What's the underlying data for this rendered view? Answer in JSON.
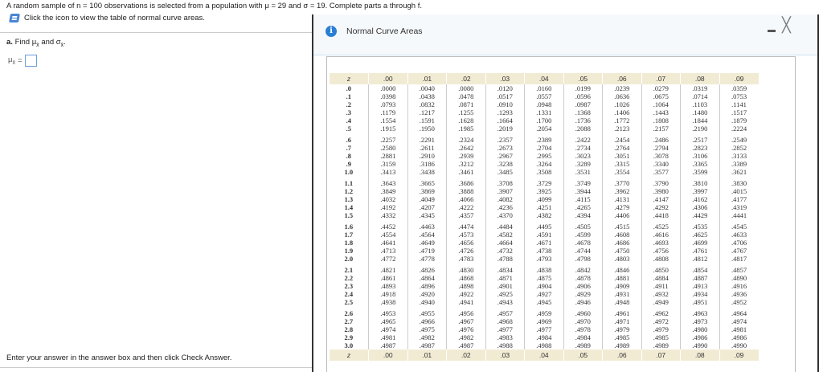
{
  "question": "A random sample of n = 100 observations is selected from a population with μ = 29 and σ = 19. Complete parts a through f.",
  "hint": "Click the icon to view the table of normal curve areas.",
  "part_a": {
    "label": "a.",
    "text": "Find μ",
    "and": "and σ",
    "sub": "x̄",
    "end": "."
  },
  "answer": {
    "label": "μ",
    "sub": "x̄",
    "eq": "=",
    "value": ""
  },
  "footer": "Enter your answer in the answer box and then click Check Answer.",
  "popup": {
    "title": "Normal Curve Areas",
    "info_icon": "i",
    "minimize": "minimize-icon",
    "close": "╳",
    "headers": [
      "z",
      ".00",
      ".01",
      ".02",
      ".03",
      ".04",
      ".05",
      ".06",
      ".07",
      ".08",
      ".09"
    ],
    "groups": [
      [
        [
          ".0",
          ".0000",
          ".0040",
          ".0080",
          ".0120",
          ".0160",
          ".0199",
          ".0239",
          ".0279",
          ".0319",
          ".0359"
        ],
        [
          ".1",
          ".0398",
          ".0438",
          ".0478",
          ".0517",
          ".0557",
          ".0596",
          ".0636",
          ".0675",
          ".0714",
          ".0753"
        ],
        [
          ".2",
          ".0793",
          ".0832",
          ".0871",
          ".0910",
          ".0948",
          ".0987",
          ".1026",
          ".1064",
          ".1103",
          ".1141"
        ],
        [
          ".3",
          ".1179",
          ".1217",
          ".1255",
          ".1293",
          ".1331",
          ".1368",
          ".1406",
          ".1443",
          ".1480",
          ".1517"
        ],
        [
          ".4",
          ".1554",
          ".1591",
          ".1628",
          ".1664",
          ".1700",
          ".1736",
          ".1772",
          ".1808",
          ".1844",
          ".1879"
        ],
        [
          ".5",
          ".1915",
          ".1950",
          ".1985",
          ".2019",
          ".2054",
          ".2088",
          ".2123",
          ".2157",
          ".2190",
          ".2224"
        ]
      ],
      [
        [
          ".6",
          ".2257",
          ".2291",
          ".2324",
          ".2357",
          ".2389",
          ".2422",
          ".2454",
          ".2486",
          ".2517",
          ".2549"
        ],
        [
          ".7",
          ".2580",
          ".2611",
          ".2642",
          ".2673",
          ".2704",
          ".2734",
          ".2764",
          ".2794",
          ".2823",
          ".2852"
        ],
        [
          ".8",
          ".2881",
          ".2910",
          ".2939",
          ".2967",
          ".2995",
          ".3023",
          ".3051",
          ".3078",
          ".3106",
          ".3133"
        ],
        [
          ".9",
          ".3159",
          ".3186",
          ".3212",
          ".3238",
          ".3264",
          ".3289",
          ".3315",
          ".3340",
          ".3365",
          ".3389"
        ],
        [
          "1.0",
          ".3413",
          ".3438",
          ".3461",
          ".3485",
          ".3508",
          ".3531",
          ".3554",
          ".3577",
          ".3599",
          ".3621"
        ]
      ],
      [
        [
          "1.1",
          ".3643",
          ".3665",
          ".3686",
          ".3708",
          ".3729",
          ".3749",
          ".3770",
          ".3790",
          ".3810",
          ".3830"
        ],
        [
          "1.2",
          ".3849",
          ".3869",
          ".3888",
          ".3907",
          ".3925",
          ".3944",
          ".3962",
          ".3980",
          ".3997",
          ".4015"
        ],
        [
          "1.3",
          ".4032",
          ".4049",
          ".4066",
          ".4082",
          ".4099",
          ".4115",
          ".4131",
          ".4147",
          ".4162",
          ".4177"
        ],
        [
          "1.4",
          ".4192",
          ".4207",
          ".4222",
          ".4236",
          ".4251",
          ".4265",
          ".4279",
          ".4292",
          ".4306",
          ".4319"
        ],
        [
          "1.5",
          ".4332",
          ".4345",
          ".4357",
          ".4370",
          ".4382",
          ".4394",
          ".4406",
          ".4418",
          ".4429",
          ".4441"
        ]
      ],
      [
        [
          "1.6",
          ".4452",
          ".4463",
          ".4474",
          ".4484",
          ".4495",
          ".4505",
          ".4515",
          ".4525",
          ".4535",
          ".4545"
        ],
        [
          "1.7",
          ".4554",
          ".4564",
          ".4573",
          ".4582",
          ".4591",
          ".4599",
          ".4608",
          ".4616",
          ".4625",
          ".4633"
        ],
        [
          "1.8",
          ".4641",
          ".4649",
          ".4656",
          ".4664",
          ".4671",
          ".4678",
          ".4686",
          ".4693",
          ".4699",
          ".4706"
        ],
        [
          "1.9",
          ".4713",
          ".4719",
          ".4726",
          ".4732",
          ".4738",
          ".4744",
          ".4750",
          ".4756",
          ".4761",
          ".4767"
        ],
        [
          "2.0",
          ".4772",
          ".4778",
          ".4783",
          ".4788",
          ".4793",
          ".4798",
          ".4803",
          ".4808",
          ".4812",
          ".4817"
        ]
      ],
      [
        [
          "2.1",
          ".4821",
          ".4826",
          ".4830",
          ".4834",
          ".4838",
          ".4842",
          ".4846",
          ".4850",
          ".4854",
          ".4857"
        ],
        [
          "2.2",
          ".4861",
          ".4864",
          ".4868",
          ".4871",
          ".4875",
          ".4878",
          ".4881",
          ".4884",
          ".4887",
          ".4890"
        ],
        [
          "2.3",
          ".4893",
          ".4896",
          ".4898",
          ".4901",
          ".4904",
          ".4906",
          ".4909",
          ".4911",
          ".4913",
          ".4916"
        ],
        [
          "2.4",
          ".4918",
          ".4920",
          ".4922",
          ".4925",
          ".4927",
          ".4929",
          ".4931",
          ".4932",
          ".4934",
          ".4936"
        ],
        [
          "2.5",
          ".4938",
          ".4940",
          ".4941",
          ".4943",
          ".4945",
          ".4946",
          ".4948",
          ".4949",
          ".4951",
          ".4952"
        ]
      ],
      [
        [
          "2.6",
          ".4953",
          ".4955",
          ".4956",
          ".4957",
          ".4959",
          ".4960",
          ".4961",
          ".4962",
          ".4963",
          ".4964"
        ],
        [
          "2.7",
          ".4965",
          ".4966",
          ".4967",
          ".4968",
          ".4969",
          ".4970",
          ".4971",
          ".4972",
          ".4973",
          ".4974"
        ],
        [
          "2.8",
          ".4974",
          ".4975",
          ".4976",
          ".4977",
          ".4977",
          ".4978",
          ".4979",
          ".4979",
          ".4980",
          ".4981"
        ],
        [
          "2.9",
          ".4981",
          ".4982",
          ".4982",
          ".4983",
          ".4984",
          ".4984",
          ".4985",
          ".4985",
          ".4986",
          ".4986"
        ],
        [
          "3.0",
          ".4987",
          ".4987",
          ".4987",
          ".4988",
          ".4988",
          ".4989",
          ".4989",
          ".4989",
          ".4990",
          ".4990"
        ]
      ]
    ]
  }
}
